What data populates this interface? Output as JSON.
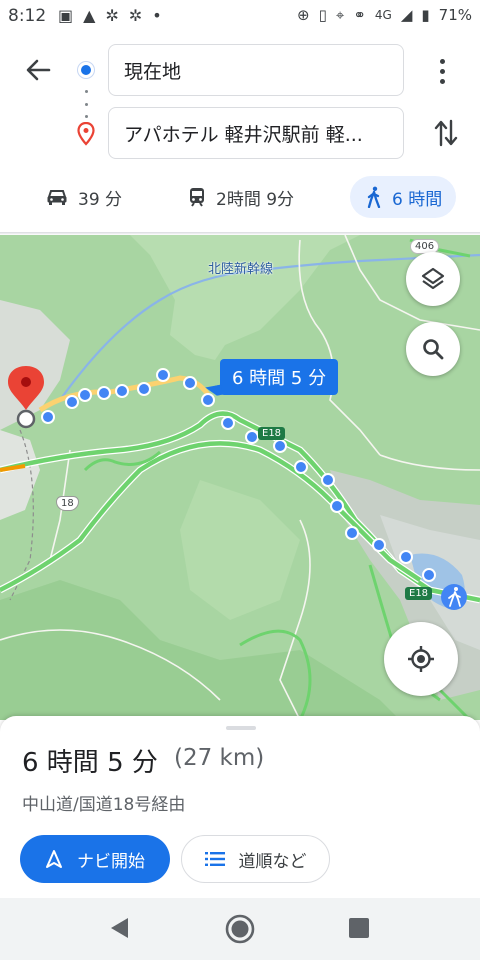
{
  "status_bar": {
    "time": "8:12",
    "network": "4G",
    "battery": "71%",
    "icons": [
      "image-icon",
      "warning-icon",
      "slack-icon",
      "slack-icon",
      "dot-icon",
      "data-saver-icon",
      "vibrate-icon",
      "location-icon",
      "voicemail-icon",
      "signal-icon",
      "battery-icon"
    ]
  },
  "directions": {
    "origin": "現在地",
    "destination": "アパホテル 軽井沢駅前 軽...",
    "modes": [
      {
        "name": "drive",
        "icon": "car-icon",
        "label": "39 分",
        "selected": false
      },
      {
        "name": "transit",
        "icon": "train-icon",
        "label": "2時間 9分",
        "selected": false
      },
      {
        "name": "walk",
        "icon": "walk-icon",
        "label": "6 時間",
        "selected": true
      }
    ]
  },
  "map": {
    "route_callout": "6 時間 5 分",
    "labels": {
      "railway": "北陸新幹線",
      "road_e18_a": "E18",
      "road_e18_b": "E18",
      "road_406": "406",
      "road_18": "18"
    },
    "colors": {
      "route": "#4285f4",
      "forest": "#a8d5a2",
      "highway": "#6ed36e"
    }
  },
  "sheet": {
    "duration": "6 時間 5 分",
    "distance": "(27 km)",
    "via": "中山道/国道18号経由",
    "start_button": "ナビ開始",
    "steps_button": "道順など"
  }
}
